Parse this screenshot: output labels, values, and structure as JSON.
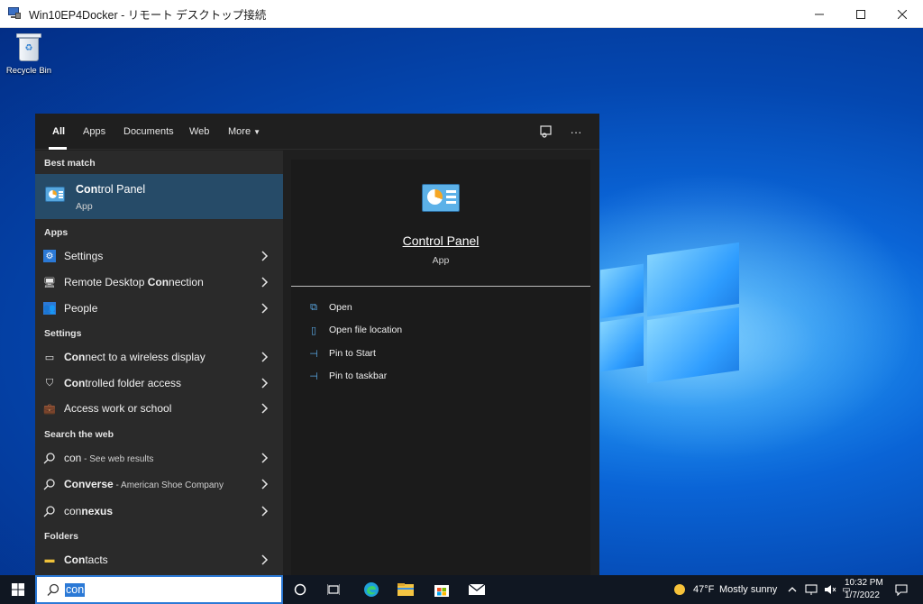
{
  "window": {
    "title": "Win10EP4Docker - リモート デスクトップ接続",
    "controls": [
      "minimize-icon",
      "maximize-icon",
      "close-icon"
    ]
  },
  "desktop": {
    "recycle_bin_label": "Recycle Bin"
  },
  "search_panel": {
    "tabs": [
      {
        "label": "All",
        "active": true
      },
      {
        "label": "Apps"
      },
      {
        "label": "Documents"
      },
      {
        "label": "Web"
      },
      {
        "label": "More"
      }
    ],
    "sections": {
      "best_match": "Best match",
      "apps": "Apps",
      "settings": "Settings",
      "search_web": "Search the web",
      "folders": "Folders"
    },
    "best_match": {
      "match": "Con",
      "rest": "trol Panel",
      "type": "App"
    },
    "apps": [
      {
        "bold": "",
        "text": "Settings",
        "icon": "gear-icon"
      },
      {
        "pre": "Remote Desktop ",
        "bold": "Con",
        "post": "nection",
        "icon": "remote-desktop-icon"
      },
      {
        "pre": "",
        "bold": "",
        "post": "People",
        "icon": "people-icon"
      }
    ],
    "settings": [
      {
        "bold": "Con",
        "post": "nect to a wireless display",
        "icon": "display-icon"
      },
      {
        "bold": "Con",
        "post": "trolled folder access",
        "icon": "shield-icon"
      },
      {
        "bold": "",
        "post": "Access work or school",
        "icon": "briefcase-icon"
      }
    ],
    "web": [
      {
        "bold": "con",
        "post": "",
        "sub": " - See web results",
        "icon": "search-icon"
      },
      {
        "bold": "Converse",
        "post": "",
        "sub": " - American Shoe Company",
        "icon": "search-icon"
      },
      {
        "bold": "",
        "pre": "con",
        "post": "nexus",
        "sub": "",
        "icon": "search-icon"
      }
    ],
    "folders": [
      {
        "bold": "Con",
        "post": "tacts",
        "icon": "folder-icon"
      }
    ],
    "preview": {
      "name": "Control Panel",
      "type": "App",
      "actions": [
        {
          "label": "Open",
          "icon": "open-icon"
        },
        {
          "label": "Open file location",
          "icon": "file-location-icon"
        },
        {
          "label": "Pin to Start",
          "icon": "pin-icon"
        },
        {
          "label": "Pin to taskbar",
          "icon": "pin-icon"
        }
      ]
    }
  },
  "taskbar": {
    "search_value": "con",
    "weather": {
      "temp": "47°F",
      "desc": "Mostly sunny"
    },
    "time": "10:32 PM",
    "date": "1/7/2022"
  },
  "colors": {
    "accent": "#2b79d6",
    "best_match_bg": "#264b68",
    "panel_bg": "#1f1f1f",
    "results_bg": "#2a2a2a",
    "taskbar_bg": "#101722"
  }
}
